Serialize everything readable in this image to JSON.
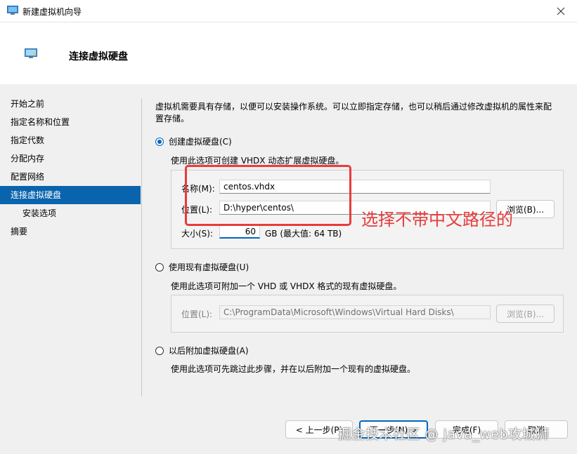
{
  "window": {
    "title": "新建虚拟机向导"
  },
  "header": {
    "title": "连接虚拟硬盘"
  },
  "nav": {
    "items": [
      {
        "label": "开始之前"
      },
      {
        "label": "指定名称和位置"
      },
      {
        "label": "指定代数"
      },
      {
        "label": "分配内存"
      },
      {
        "label": "配置网络"
      },
      {
        "label": "连接虚拟硬盘"
      },
      {
        "label": "安装选项"
      },
      {
        "label": "摘要"
      }
    ]
  },
  "content": {
    "description": "虚拟机需要具有存储，以便可以安装操作系统。可以立即指定存储，也可以稍后通过修改虚拟机的属性来配置存储。",
    "create": {
      "label": "创建虚拟硬盘(C)",
      "hint": "使用此选项可创建 VHDX 动态扩展虚拟硬盘。",
      "name_label": "名称(M):",
      "name_value": "centos.vhdx",
      "location_label": "位置(L):",
      "location_value": "D:\\hyper\\centos\\",
      "browse_label": "浏览(B)...",
      "size_label": "大小(S):",
      "size_value": "60",
      "size_unit": "GB (最大值: 64 TB)"
    },
    "existing": {
      "label": "使用现有虚拟硬盘(U)",
      "hint": "使用此选项可附加一个 VHD 或 VHDX 格式的现有虚拟硬盘。",
      "location_label": "位置(L):",
      "location_value": "C:\\ProgramData\\Microsoft\\Windows\\Virtual Hard Disks\\",
      "browse_label": "浏览(B)..."
    },
    "later": {
      "label": "以后附加虚拟硬盘(A)",
      "hint": "使用此选项可先跳过此步骤，并在以后附加一个现有的虚拟硬盘。"
    }
  },
  "annotation": {
    "text": "选择不带中文路径的"
  },
  "footer": {
    "prev_label": "< 上一步(P)",
    "next_label": "下一步(N) >",
    "finish_label": "完成(F)",
    "cancel_label": "取消"
  },
  "watermark": {
    "text": "掘金技术社区 @ java_web攻城狮"
  },
  "colors": {
    "accent": "#0a64ad",
    "annotation": "#e93b3b"
  }
}
